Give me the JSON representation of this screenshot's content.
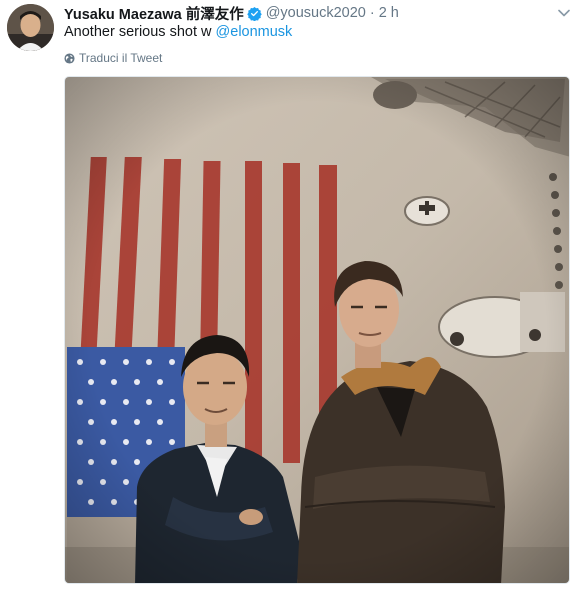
{
  "tweet": {
    "author_name": "Yusaku Maezawa 前澤友作",
    "handle": "@yousuck2020",
    "separator": "·",
    "time": "2 h",
    "text_prefix": "Another serious shot w ",
    "mention": "@elonmusk",
    "translate_label": "Traduci il Tweet"
  },
  "colors": {
    "link": "#1b95e0",
    "muted": "#657786",
    "verified": "#1da1f2"
  },
  "icons": {
    "verified": "verified-badge-icon",
    "caret": "chevron-down-icon",
    "translate": "globe-icon"
  }
}
